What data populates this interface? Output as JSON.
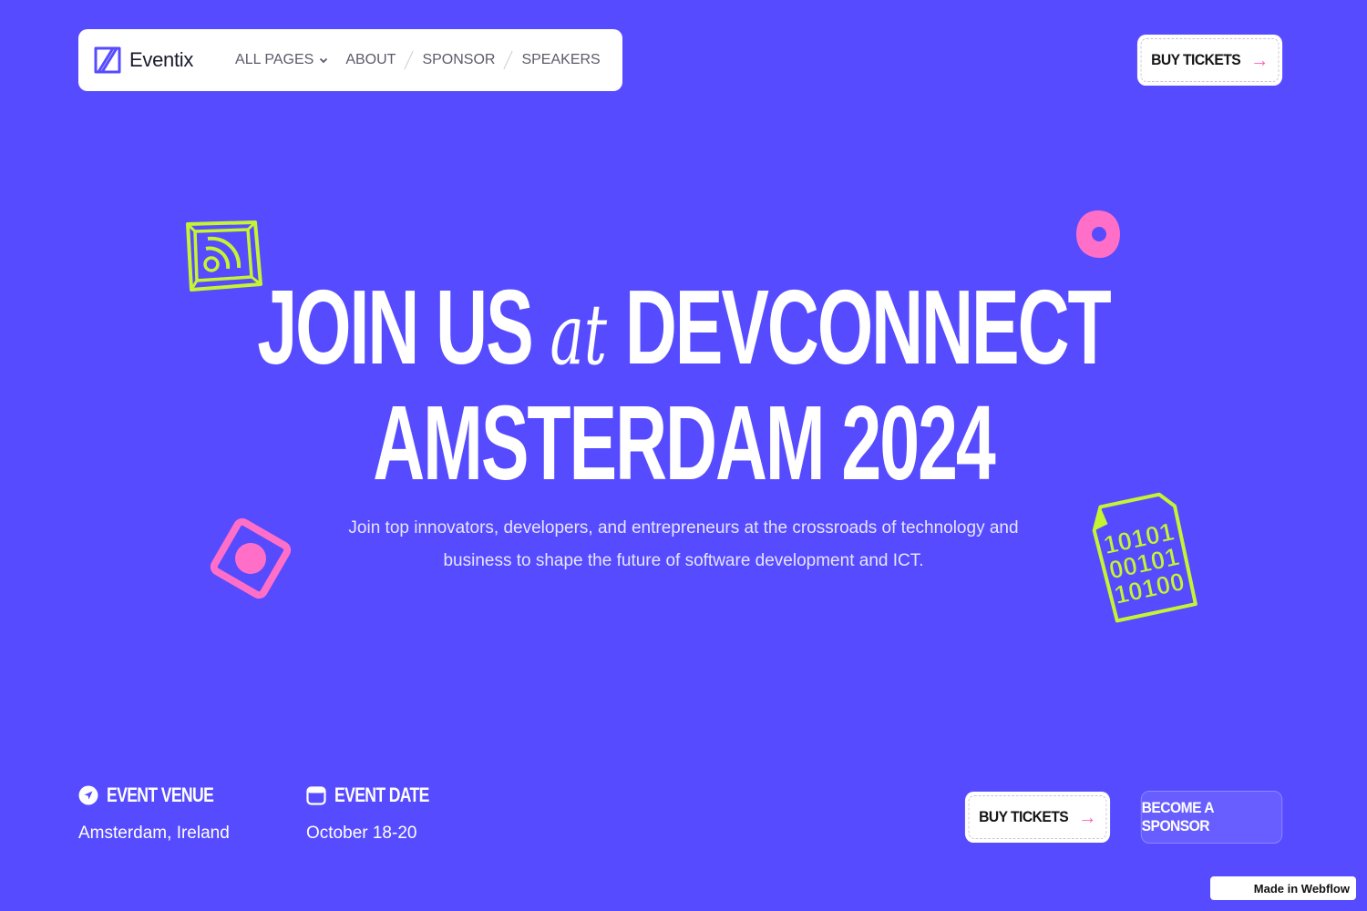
{
  "brand": {
    "name": "Eventix",
    "logo_icon": "eventix-logo-icon"
  },
  "nav": {
    "items": [
      {
        "label": "ALL PAGES",
        "has_dropdown": true
      },
      {
        "label": "ABOUT"
      },
      {
        "label": "SPONSOR"
      },
      {
        "label": "SPEAKERS"
      }
    ]
  },
  "header": {
    "cta_label": "BUY TICKETS"
  },
  "hero": {
    "title_line1_a": "JOIN US",
    "title_line1_accent": "at",
    "title_line1_b": "DEVCONNECT",
    "title_line2": "AMSTERDAM 2024",
    "subtitle": "Join top innovators, developers, and entrepreneurs at the crossroads of technology and business to shape the future of software development and ICT."
  },
  "event": {
    "venue_label": "EVENT VENUE",
    "venue_value": "Amsterdam, Ireland",
    "date_label": "EVENT DATE",
    "date_value": "October 18-20"
  },
  "actions": {
    "buy_label": "BUY TICKETS",
    "sponsor_label": "BECOME A SPONSOR"
  },
  "decor": {
    "binary_text": [
      "10101",
      "00101",
      "10100"
    ]
  },
  "badge": {
    "label": "Made in Webflow"
  },
  "colors": {
    "background": "#564bff",
    "lime": "#c6f432",
    "pink": "#ff6ec7",
    "accent_arrow": "#ff5fb7"
  }
}
